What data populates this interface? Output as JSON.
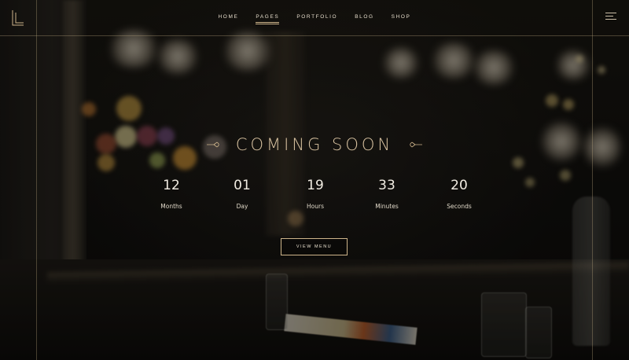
{
  "nav": {
    "items": [
      {
        "label": "HOME"
      },
      {
        "label": "PAGES",
        "active": true
      },
      {
        "label": "PORTFOLIO"
      },
      {
        "label": "BLOG"
      },
      {
        "label": "SHOP"
      }
    ]
  },
  "hero": {
    "title": "COMING SOON",
    "countdown": [
      {
        "value": "12",
        "label": "Months"
      },
      {
        "value": "01",
        "label": "Day"
      },
      {
        "value": "19",
        "label": "Hours"
      },
      {
        "value": "33",
        "label": "Minutes"
      },
      {
        "value": "20",
        "label": "Seconds"
      }
    ],
    "button_label": "VIEW MENU"
  },
  "icons": {
    "logo": "logo-icon",
    "menu": "hamburger-menu-icon",
    "ornament": "ornament-icon"
  },
  "colors": {
    "accent": "#cdb48a",
    "title": "#d8c2a0",
    "text": "#f1ece2",
    "background": "#0d0d0c"
  }
}
